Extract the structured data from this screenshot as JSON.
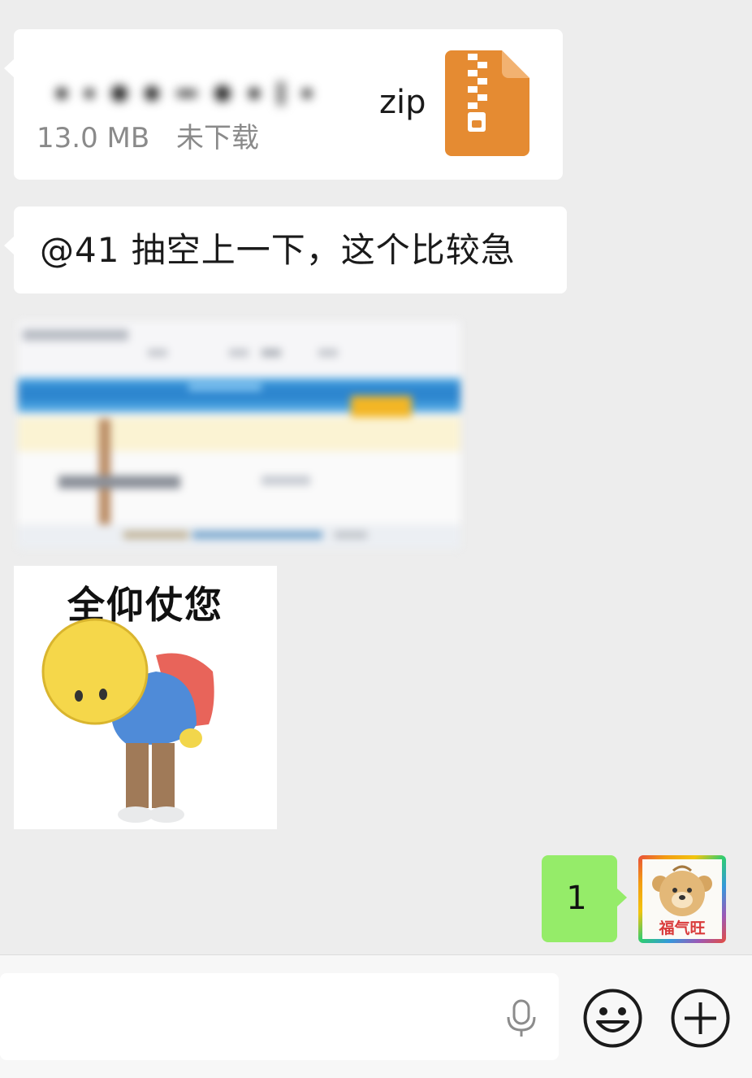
{
  "messages": {
    "file": {
      "name_suffix": "zip",
      "size": "13.0 MB",
      "status": "未下载",
      "icon": "zip-file-icon",
      "icon_color": "#e58b32"
    },
    "text": {
      "content": "@41  抽空上一下，这个比较急"
    },
    "sticker": {
      "caption": "全仰仗您"
    },
    "sent": {
      "content": "1",
      "bubble_color": "#95ec69"
    },
    "avatar": {
      "label": "福气旺"
    }
  },
  "input_bar": {
    "mic_icon": "microphone-icon",
    "emoji_icon": "smiley-icon",
    "plus_icon": "plus-circle-icon"
  }
}
